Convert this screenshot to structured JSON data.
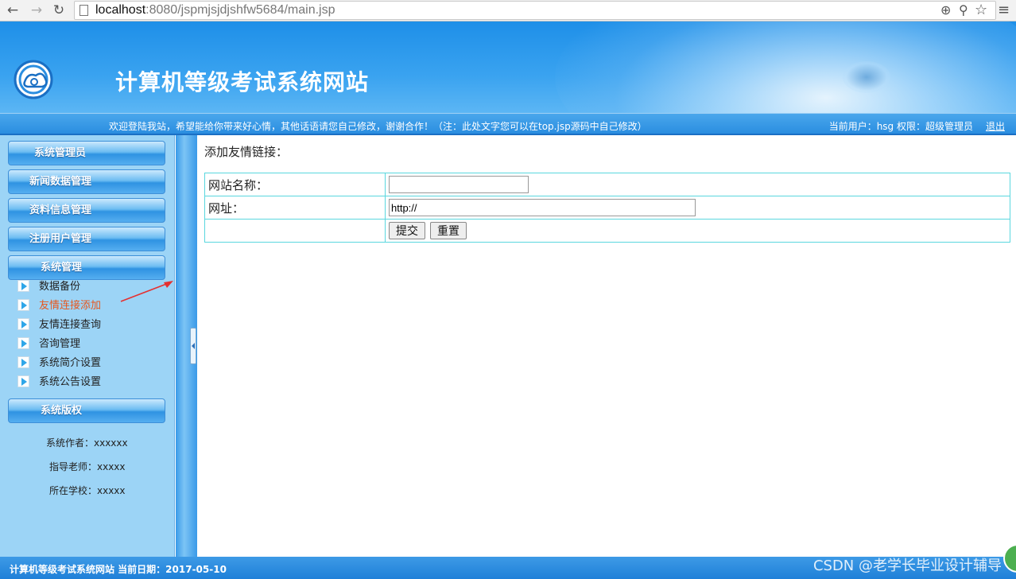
{
  "browser": {
    "url_host": "localhost",
    "url_path": ":8080/jspmjsjdjshfw5684/main.jsp",
    "back_icon": "arrow-left-icon",
    "forward_icon": "arrow-right-icon",
    "reload_icon": "reload-icon"
  },
  "header": {
    "site_title": "计算机等级考试系统网站",
    "marquee": "欢迎登陆我站，希望能给你带来好心情，其他话语请您自己修改，谢谢合作！（注：此处文字您可以在top.jsp源码中自己修改）",
    "current_user_label": "当前用户：hsg  权限：超级管理员",
    "logout": "退出"
  },
  "sidebar": {
    "sections": [
      {
        "label": "系统管理员"
      },
      {
        "label": "新闻数据管理"
      },
      {
        "label": "资料信息管理"
      },
      {
        "label": "注册用户管理"
      },
      {
        "label": "系统管理"
      }
    ],
    "system_items": [
      {
        "label": "数据备份"
      },
      {
        "label": "友情连接添加"
      },
      {
        "label": "友情连接查询"
      },
      {
        "label": "咨询管理"
      },
      {
        "label": "系统简介设置"
      },
      {
        "label": "系统公告设置"
      }
    ],
    "copyright_head": "系统版权",
    "credits": {
      "author": "系统作者：xxxxxx",
      "teacher": "指导老师：xxxxx",
      "school": "所在学校：xxxxx"
    }
  },
  "main": {
    "title": "添加友情链接：",
    "site_name_label": "网站名称：",
    "site_name_value": "",
    "url_label": "网址：",
    "url_value": "http://",
    "submit": "提交",
    "reset": "重置"
  },
  "footer": {
    "text": "计算机等级考试系统网站  当前日期：2017-05-10",
    "watermark": "CSDN @老学长毕业设计辅导"
  },
  "colors": {
    "banner": "#2a96ea",
    "sidebar_bg": "#9cd4f6",
    "active_item": "#e8561c",
    "table_border": "#5ad7df"
  }
}
